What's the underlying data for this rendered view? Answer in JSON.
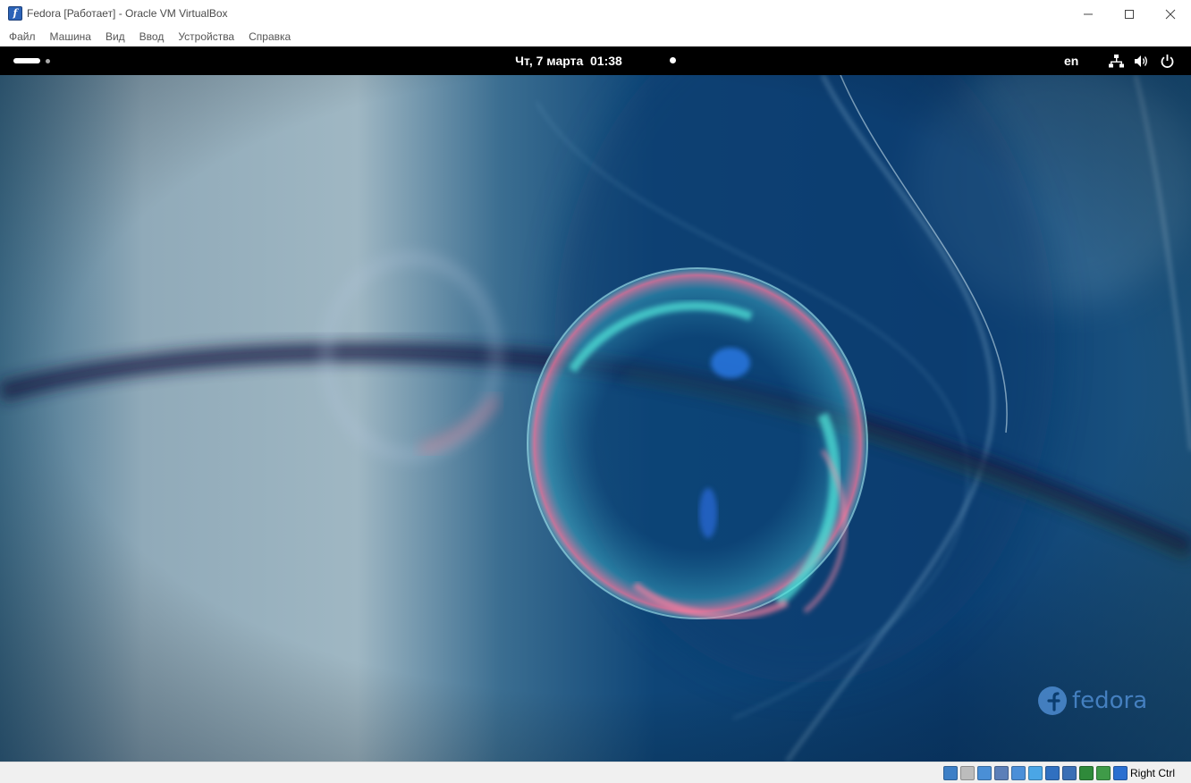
{
  "window": {
    "title": "Fedora [Работает] - Oracle VM VirtualBox",
    "app_icon_glyph": "f"
  },
  "menu": {
    "items": [
      {
        "label": "Файл"
      },
      {
        "label": "Машина"
      },
      {
        "label": "Вид"
      },
      {
        "label": "Ввод"
      },
      {
        "label": "Устройства"
      },
      {
        "label": "Справка"
      }
    ]
  },
  "gnome": {
    "clock": "Чт, 7 марта  01:38",
    "keyboard_layout": "en",
    "tray_icons": [
      "network-icon",
      "volume-icon",
      "power-icon"
    ]
  },
  "desktop": {
    "brand_wordmark": "fedora"
  },
  "statusbar": {
    "host_key": "Right Ctrl",
    "icons": [
      "hard-disk-icon",
      "optical-drive-icon",
      "audio-icon",
      "network-adapter-icon",
      "usb-icon",
      "shared-folders-icon",
      "display-icon",
      "video-capture-icon",
      "cpu-icon",
      "mouse-integration-icon",
      "keyboard-capture-icon"
    ],
    "icon_colors": [
      "#3d7fc6",
      "#bcbcbc",
      "#4a8fd6",
      "#5b7fb8",
      "#4b8fd8",
      "#4aa6e6",
      "#3070c0",
      "#3b6fb5",
      "#2f8a3a",
      "#3f9b48",
      "#2a6fd0"
    ]
  },
  "colors": {
    "gnome_bar": "#000000",
    "fedora_blue": "#4d8bd0"
  }
}
